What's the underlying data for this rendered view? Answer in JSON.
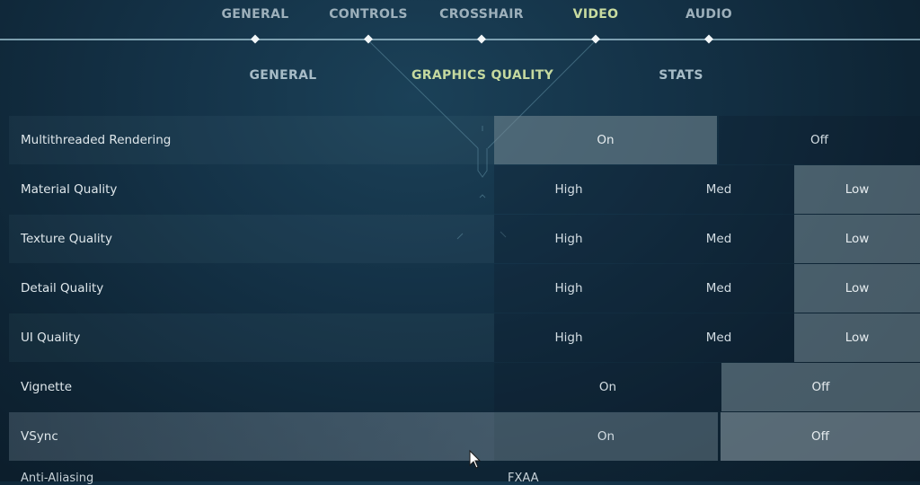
{
  "top_nav": {
    "tabs": [
      {
        "label": "GENERAL",
        "active": false
      },
      {
        "label": "CONTROLS",
        "active": false
      },
      {
        "label": "CROSSHAIR",
        "active": false
      },
      {
        "label": "VIDEO",
        "active": true
      },
      {
        "label": "AUDIO",
        "active": false
      }
    ]
  },
  "sub_tabs": [
    {
      "label": "GENERAL",
      "active": false
    },
    {
      "label": "GRAPHICS QUALITY",
      "active": true
    },
    {
      "label": "STATS",
      "active": false
    }
  ],
  "settings": [
    {
      "label": "Multithreaded Rendering",
      "options": [
        "On",
        "Off"
      ],
      "selected": "On"
    },
    {
      "label": "Material Quality",
      "options": [
        "High",
        "Med",
        "Low"
      ],
      "selected": "Low"
    },
    {
      "label": "Texture Quality",
      "options": [
        "High",
        "Med",
        "Low"
      ],
      "selected": "Low"
    },
    {
      "label": "Detail Quality",
      "options": [
        "High",
        "Med",
        "Low"
      ],
      "selected": "Low"
    },
    {
      "label": "UI Quality",
      "options": [
        "High",
        "Med",
        "Low"
      ],
      "selected": "Low"
    },
    {
      "label": "Vignette",
      "options": [
        "On",
        "Off"
      ],
      "selected": "Off"
    },
    {
      "label": "VSync",
      "options": [
        "On",
        "Off"
      ],
      "selected": "Off"
    }
  ],
  "partial_row": {
    "label": "Anti-Aliasing",
    "visible_option": "FXAA"
  },
  "colors": {
    "active_tab": "#c9dca0",
    "inactive_tab": "#9db0bb",
    "selected_option_bg": "#6f8088",
    "background": "#143247"
  }
}
